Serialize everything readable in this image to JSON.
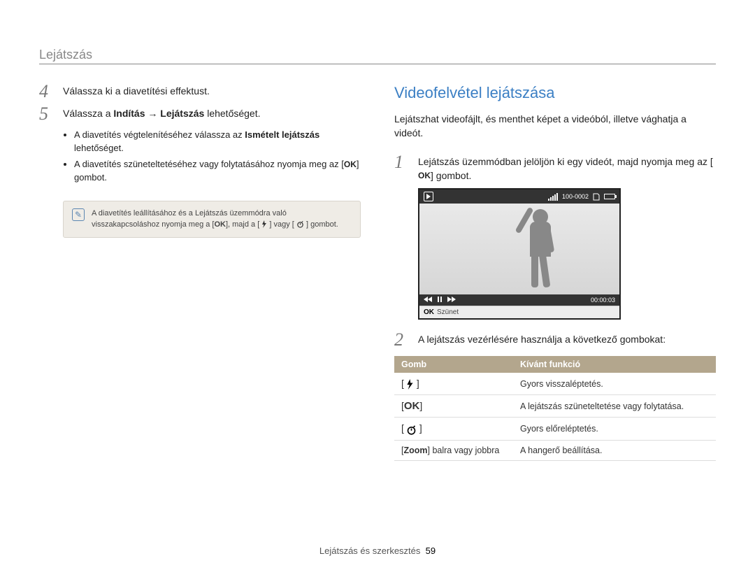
{
  "header": {
    "title": "Lejátszás"
  },
  "left": {
    "step4": {
      "num": "4",
      "text": "Válassza ki a diavetítési effektust."
    },
    "step5": {
      "num": "5",
      "prefix": "Válassza a ",
      "bold1": "Indítás",
      "arrow": " → ",
      "bold2": "Lejátszás",
      "suffix": " lehetőséget."
    },
    "bullet1": {
      "prefix": "A diavetítés végtelenítéséhez válassza az ",
      "bold": "Ismételt lejátszás",
      "suffix": " lehetőséget."
    },
    "bullet2": {
      "prefix": "A diavetítés szüneteltetéséhez vagy folytatásához nyomja meg az [",
      "ok": "OK",
      "suffix": "] gombot."
    },
    "note": {
      "line1": "A diavetítés leállításához és a Lejátszás üzemmódra való",
      "line2_a": "visszakapcsoláshoz nyomja meg a [",
      "ok": "OK",
      "line2_b": "], majd a [",
      "line2_c": "] vagy [",
      "line2_d": "] gombot."
    }
  },
  "right": {
    "title": "Videofelvétel lejátszása",
    "intro": "Lejátszhat videofájlt, és menthet képet a videóból, illetve vághatja a videót.",
    "step1": {
      "num": "1",
      "text_a": "Lejátszás üzemmódban jelöljön ki egy videót, majd nyomja meg az [",
      "ok": "OK",
      "text_b": "] gombot."
    },
    "thumb": {
      "counter": "100-0002",
      "time": "00:00:03",
      "status_ok": "OK",
      "status_text": "Szünet"
    },
    "step2": {
      "num": "2",
      "text": "A lejátszás vezérlésére használja a következő gombokat:"
    },
    "table": {
      "h1": "Gomb",
      "h2": "Kívánt funkció",
      "rows": [
        {
          "icon": "flash",
          "text": "Gyors visszaléptetés."
        },
        {
          "icon": "ok",
          "text": "A lejátszás szüneteltetése vagy folytatása."
        },
        {
          "icon": "timer",
          "text": "Gyors előreléptetés."
        },
        {
          "icon": "zoom",
          "label_a": "[",
          "label_bold": "Zoom",
          "label_b": "] balra vagy jobbra",
          "text": "A hangerő beállítása."
        }
      ]
    }
  },
  "footer": {
    "text": "Lejátszás és szerkesztés",
    "page": "59"
  }
}
